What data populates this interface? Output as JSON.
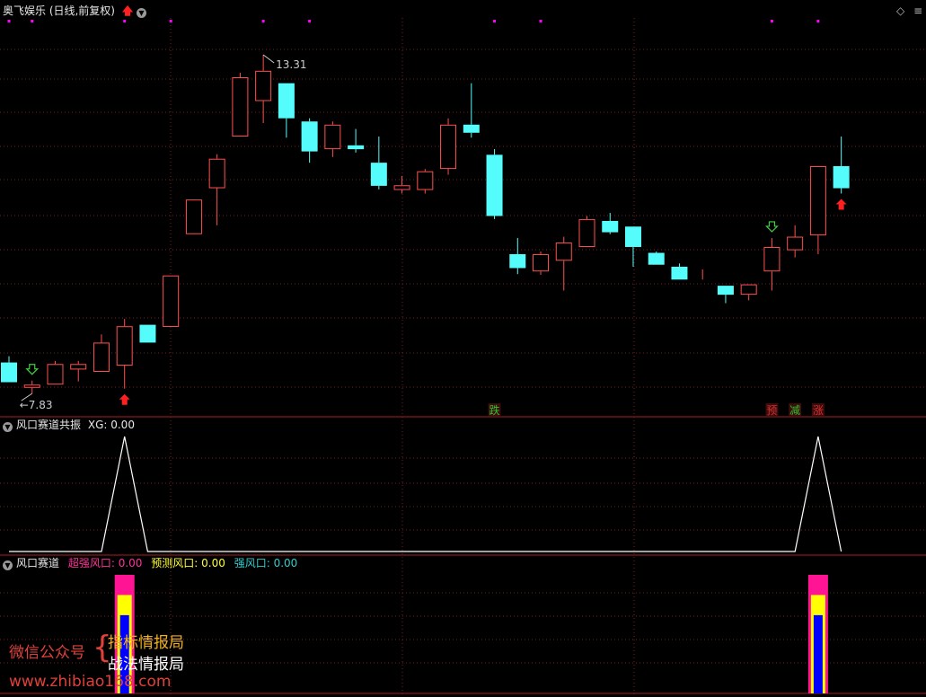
{
  "header": {
    "title": "奥飞娱乐 (日线,前复权)",
    "diamond": "◇",
    "menu": "≡"
  },
  "panel2": {
    "name": "风口赛道共振",
    "xg_label": "XG:",
    "xg_value": "0.00"
  },
  "panel3": {
    "name": "风口赛道",
    "items": [
      {
        "label": "超强风口:",
        "value": "0.00",
        "color": "#ff3399"
      },
      {
        "label": "预测风口:",
        "value": "0.00",
        "color": "#ffff33"
      },
      {
        "label": "强风口:",
        "value": "0.00",
        "color": "#33cccc"
      }
    ]
  },
  "watermark": {
    "left": "微信公众号",
    "line1": "指标情报局",
    "line2": "战法情报局",
    "url": "www.zhibiao168.com"
  },
  "colors": {
    "up": "#ff5050",
    "down": "#54fcfc",
    "grid": "#7a1f1f",
    "divider": "#a82020",
    "magenta": "#ff00ff",
    "label_red": "#d93030",
    "label_green": "#30c030"
  },
  "chart_data": [
    {
      "type": "candlestick",
      "y_scale": "log",
      "ylim": [
        7.55,
        14.1
      ],
      "annotations": {
        "high": "13.31",
        "low": "7.83"
      },
      "candles": [
        {
          "o": 8.22,
          "h": 8.3,
          "l": 7.97,
          "c": 7.97
        },
        {
          "o": 7.9,
          "h": 7.99,
          "l": 7.83,
          "c": 7.94
        },
        {
          "o": 7.94,
          "h": 8.24,
          "l": 7.94,
          "c": 8.2
        },
        {
          "o": 8.13,
          "h": 8.24,
          "l": 7.98,
          "c": 8.2
        },
        {
          "o": 8.1,
          "h": 8.59,
          "l": 8.1,
          "c": 8.48
        },
        {
          "o": 8.18,
          "h": 8.8,
          "l": 7.89,
          "c": 8.7
        },
        {
          "o": 8.72,
          "h": 8.72,
          "l": 8.48,
          "c": 8.48
        },
        {
          "o": 8.69,
          "h": 9.42,
          "l": 8.69,
          "c": 9.42
        },
        {
          "o": 10.05,
          "h": 10.05,
          "l": 10.05,
          "c": 10.61
        },
        {
          "o": 10.8,
          "h": 11.39,
          "l": 10.19,
          "c": 11.31
        },
        {
          "o": 11.71,
          "h": 12.94,
          "l": 11.71,
          "c": 12.85
        },
        {
          "o": 12.38,
          "h": 13.31,
          "l": 11.96,
          "c": 12.98
        },
        {
          "o": 12.73,
          "h": 12.73,
          "l": 11.69,
          "c": 12.05
        },
        {
          "o": 11.99,
          "h": 12.05,
          "l": 11.24,
          "c": 11.44
        },
        {
          "o": 11.48,
          "h": 11.99,
          "l": 11.34,
          "c": 11.93
        },
        {
          "o": 11.55,
          "h": 11.85,
          "l": 11.42,
          "c": 11.48
        },
        {
          "o": 11.24,
          "h": 11.71,
          "l": 10.78,
          "c": 10.84
        },
        {
          "o": 10.77,
          "h": 11.01,
          "l": 10.71,
          "c": 10.85
        },
        {
          "o": 10.77,
          "h": 11.13,
          "l": 10.71,
          "c": 11.09
        },
        {
          "o": 11.13,
          "h": 12.05,
          "l": 11.03,
          "c": 11.93
        },
        {
          "o": 11.93,
          "h": 12.73,
          "l": 11.69,
          "c": 11.78
        },
        {
          "o": 11.38,
          "h": 11.48,
          "l": 10.29,
          "c": 10.34
        },
        {
          "o": 9.74,
          "h": 9.99,
          "l": 9.44,
          "c": 9.53
        },
        {
          "o": 9.48,
          "h": 9.78,
          "l": 9.43,
          "c": 9.74
        },
        {
          "o": 9.64,
          "h": 10.01,
          "l": 9.2,
          "c": 9.92
        },
        {
          "o": 9.85,
          "h": 10.34,
          "l": 9.85,
          "c": 10.29
        },
        {
          "o": 10.26,
          "h": 10.39,
          "l": 10.05,
          "c": 10.08
        },
        {
          "o": 10.17,
          "h": 10.17,
          "l": 9.55,
          "c": 9.85
        },
        {
          "o": 9.76,
          "h": 9.78,
          "l": 9.58,
          "c": 9.58
        },
        {
          "o": 9.55,
          "h": 9.6,
          "l": 9.36,
          "c": 9.36
        },
        {
          "o": 9.38,
          "h": 9.51,
          "l": 9.36,
          "c": 9.38
        },
        {
          "o": 9.27,
          "h": 9.27,
          "l": 9.02,
          "c": 9.14
        },
        {
          "o": 9.14,
          "h": 9.29,
          "l": 9.06,
          "c": 9.29
        },
        {
          "o": 9.48,
          "h": 9.99,
          "l": 9.2,
          "c": 9.85
        },
        {
          "o": 9.8,
          "h": 10.19,
          "l": 9.69,
          "c": 10.01
        },
        {
          "o": 10.03,
          "h": 11.18,
          "l": 9.74,
          "c": 11.18
        },
        {
          "o": 11.18,
          "h": 11.71,
          "l": 10.71,
          "c": 10.8
        }
      ],
      "arrows": [
        {
          "index": 1,
          "dir": "down",
          "style": "hollow"
        },
        {
          "index": 5,
          "dir": "up",
          "style": "solid"
        },
        {
          "index": 33,
          "dir": "down",
          "style": "hollow"
        },
        {
          "index": 36,
          "dir": "up",
          "style": "solid"
        }
      ],
      "labels": [
        {
          "index": 21,
          "text": "跌",
          "color": "#30c030"
        },
        {
          "index": 33,
          "text": "预",
          "color": "#d93030"
        },
        {
          "index": 34,
          "text": "减",
          "color": "#30c030"
        },
        {
          "index": 35,
          "text": "涨",
          "color": "#d93030"
        }
      ],
      "top_marks": [
        0,
        1,
        5,
        7,
        11,
        13,
        21,
        23,
        33,
        35
      ]
    },
    {
      "type": "line",
      "name": "XG",
      "ylim": [
        0,
        1
      ],
      "values": [
        0,
        0,
        0,
        0,
        0,
        1,
        0,
        0,
        0,
        0,
        0,
        0,
        0,
        0,
        0,
        0,
        0,
        0,
        0,
        0,
        0,
        0,
        0,
        0,
        0,
        0,
        0,
        0,
        0,
        0,
        0,
        0,
        0,
        0,
        0,
        1,
        0
      ]
    },
    {
      "type": "bar",
      "stacked_overlap": true,
      "series": [
        {
          "name": "超强风口",
          "color": "#ff1493",
          "values": {
            "5": 1,
            "35": 1
          }
        },
        {
          "name": "预测风口",
          "color": "#ffff00",
          "values": {
            "5": 0.83,
            "35": 0.83
          }
        },
        {
          "name": "强风口",
          "color": "#0000ff",
          "values": {
            "5": 0.66,
            "35": 0.66
          }
        }
      ]
    }
  ]
}
